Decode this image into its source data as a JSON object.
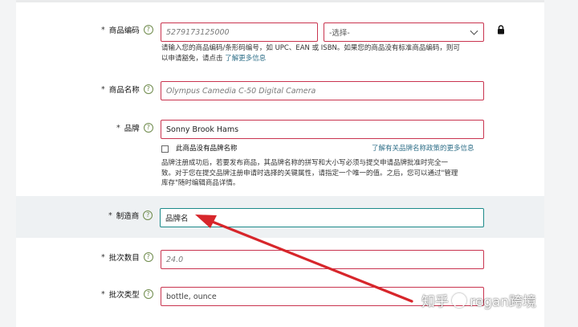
{
  "fields": {
    "product_code": {
      "label": "商品编码",
      "value": "5279173125000",
      "type_select": "-选择-",
      "hint_line1_prefix": "请输入您的商品编码/条形码编号，如 UPC、EAN 或 ISBN。如果您的商品没有标准商品编码，则可",
      "hint_line2_prefix": "以申请豁免，请点击 ",
      "hint_link": "了解更多信息"
    },
    "product_name": {
      "label": "商品名称",
      "value": "Olympus Camedia C-50 Digital Camera"
    },
    "brand": {
      "label": "品牌",
      "value": "Sonny Brook Hams",
      "no_brand_checkbox": "此商品没有品牌名称",
      "policy_link": "了解有关品牌名称政策的更多信息",
      "hint_line1": "品牌注册成功后，若要发布商品，其品牌名称的拼写和大小写必须与提交申请品牌批准时完全一",
      "hint_line2": "致。对于您在提交品牌注册申请时选择的关键属性，请指定一个唯一的值。之后，您可以通过\"管理",
      "hint_line3": "库存\"随时编辑商品详情。"
    },
    "manufacturer": {
      "label": "制造商",
      "value": "品牌名"
    },
    "batch_quantity": {
      "label": "批次数目",
      "value": "24.0"
    },
    "batch_type": {
      "label": "批次类型",
      "value": "bottle, ounce"
    }
  },
  "required_marker": "*",
  "help_glyph": "?",
  "watermark": {
    "text_left": "知乎",
    "text_right": "regan跨境"
  },
  "colors": {
    "error_border": "#c9344f",
    "focus_border": "#1c8a8a",
    "arrow": "#d7262b",
    "link": "#2f6f88"
  },
  "icons": [
    "help-icon",
    "lock-icon",
    "chevron-down-icon",
    "checkbox"
  ]
}
